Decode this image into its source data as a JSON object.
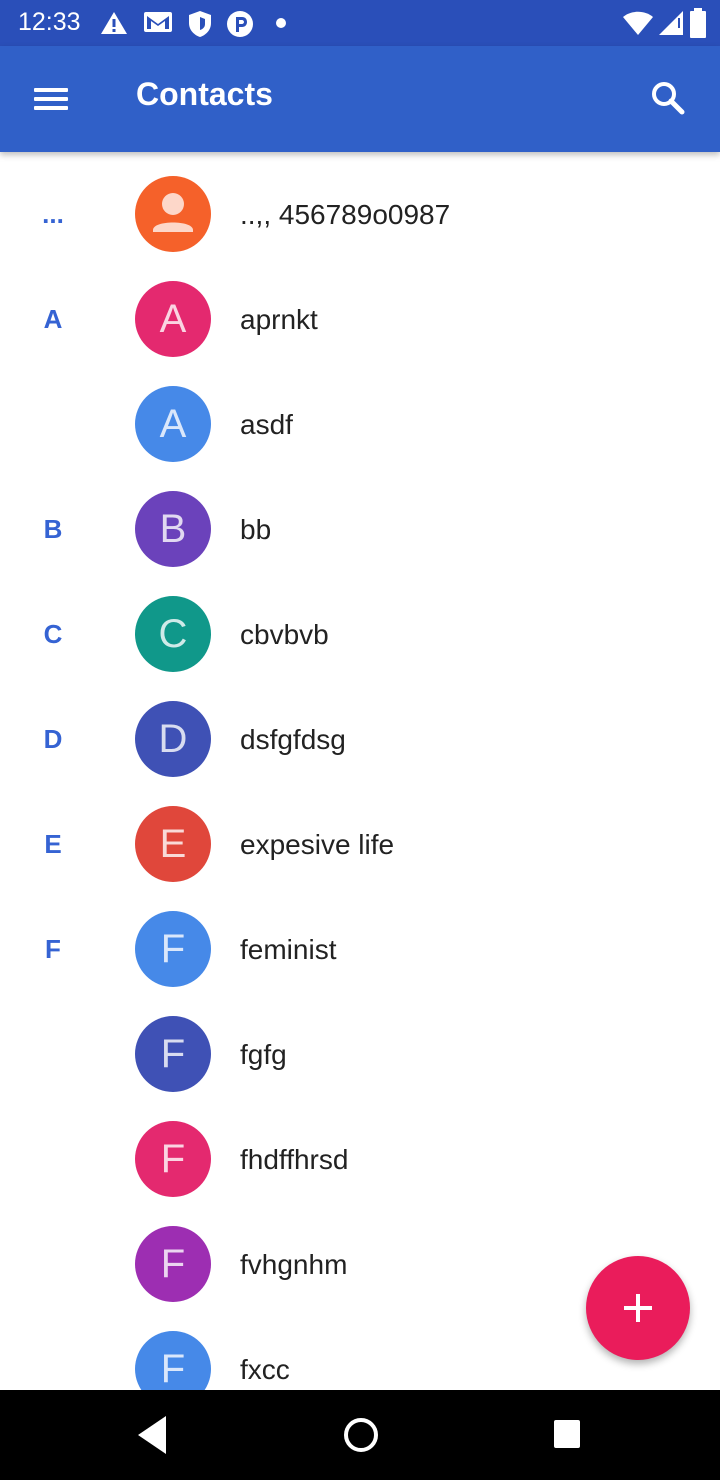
{
  "status_bar": {
    "time": "12:33",
    "icons": [
      "alert-icon",
      "gmail-icon",
      "shield-icon",
      "p-icon",
      "dot-icon",
      "wifi-icon",
      "signal-icon",
      "battery-icon"
    ]
  },
  "app_bar": {
    "title": "Contacts",
    "menu_icon": "hamburger-menu-icon",
    "search_icon": "search-icon",
    "color": "#3060c8"
  },
  "contacts": [
    {
      "section": "...",
      "initial": "",
      "name": "..,, 456789o0987",
      "color": "#f5612a",
      "person_icon": true
    },
    {
      "section": "A",
      "initial": "A",
      "name": "aprnkt",
      "color": "#e4296f"
    },
    {
      "section": "",
      "initial": "A",
      "name": "asdf",
      "color": "#4689e8"
    },
    {
      "section": "B",
      "initial": "B",
      "name": "bb",
      "color": "#6b42bb"
    },
    {
      "section": "C",
      "initial": "C",
      "name": "cbvbvb",
      "color": "#10988a"
    },
    {
      "section": "D",
      "initial": "D",
      "name": "dsfgfdsg",
      "color": "#3f51b5"
    },
    {
      "section": "E",
      "initial": "E",
      "name": "expesive life",
      "color": "#e0473b"
    },
    {
      "section": "F",
      "initial": "F",
      "name": "feminist",
      "color": "#4689e8"
    },
    {
      "section": "",
      "initial": "F",
      "name": "fgfg",
      "color": "#3f51b5"
    },
    {
      "section": "",
      "initial": "F",
      "name": "fhdffhrsd",
      "color": "#e4296f"
    },
    {
      "section": "",
      "initial": "F",
      "name": "fvhgnhm",
      "color": "#9d2eb2"
    },
    {
      "section": "",
      "initial": "F",
      "name": "fxcc",
      "color": "#4689e8"
    }
  ],
  "fab": {
    "icon": "plus-icon",
    "color": "#ea1c5b"
  },
  "nav_bar": {
    "buttons": [
      "back-icon",
      "home-icon",
      "recents-icon"
    ]
  }
}
